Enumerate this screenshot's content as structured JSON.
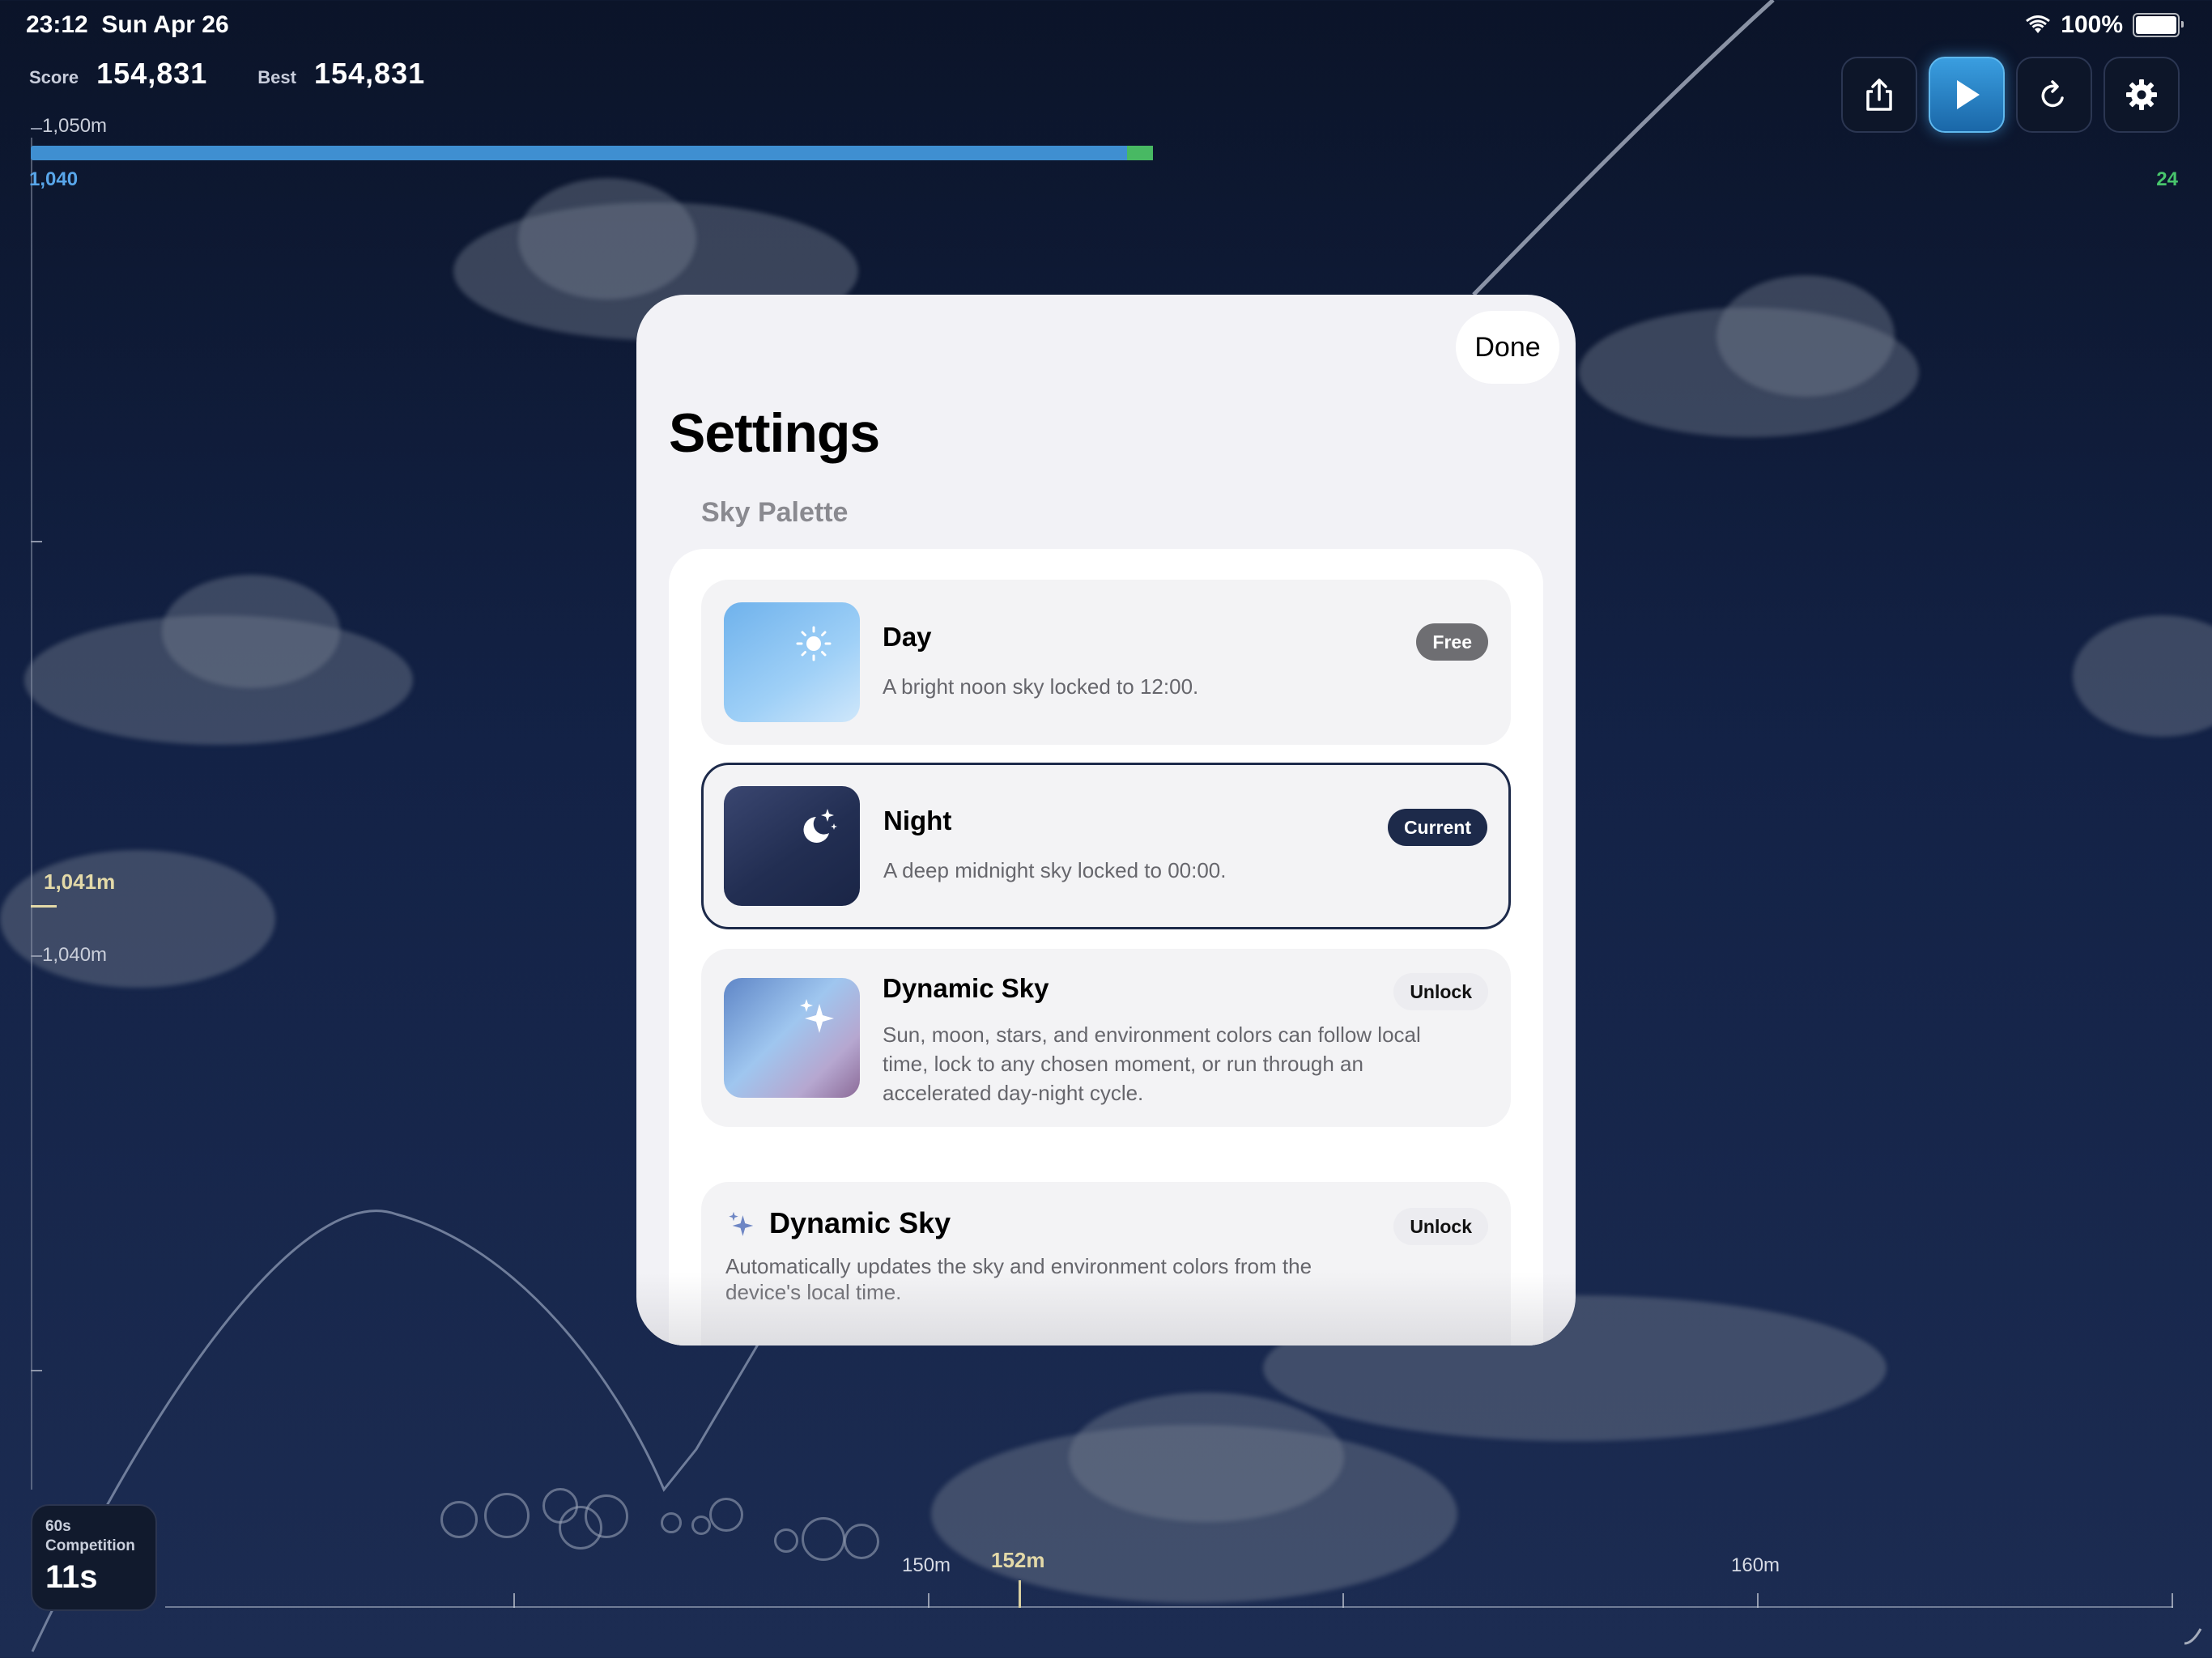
{
  "status_bar": {
    "time": "23:12",
    "date": "Sun Apr 26",
    "battery": "100%"
  },
  "hud": {
    "score_label": "Score",
    "score_value": "154,831",
    "best_label": "Best",
    "best_value": "154,831",
    "altitude_top": "1,050m",
    "altitude_current": "1,041m",
    "altitude_low": "1,040m",
    "progress_left": "1,040",
    "progress_right": "24",
    "progress_fraction": 0.98
  },
  "toolbar": {
    "icons": [
      "share-icon",
      "play-icon",
      "refresh-icon",
      "gear-icon"
    ]
  },
  "distance_axis": {
    "label_150": "150m",
    "label_current": "152m",
    "label_160": "160m"
  },
  "competition": {
    "title_line1": "60s",
    "title_line2": "Competition",
    "value": "11s"
  },
  "settings": {
    "done_label": "Done",
    "title": "Settings",
    "section_label": "Sky Palette",
    "palettes": [
      {
        "title": "Day",
        "badge": "Free",
        "description": "A bright noon sky locked to 12:00."
      },
      {
        "title": "Night",
        "badge": "Current",
        "description": "A deep midnight sky locked to 00:00."
      },
      {
        "title": "Dynamic Sky",
        "badge": "Unlock",
        "description": "Sun, moon, stars, and environment colors can follow local time, lock to any chosen moment, or run through an accelerated day-night cycle."
      }
    ],
    "dynamic_section": {
      "title": "Dynamic Sky",
      "badge": "Unlock",
      "description": "Automatically updates the sky and environment colors from the device's local time."
    }
  }
}
